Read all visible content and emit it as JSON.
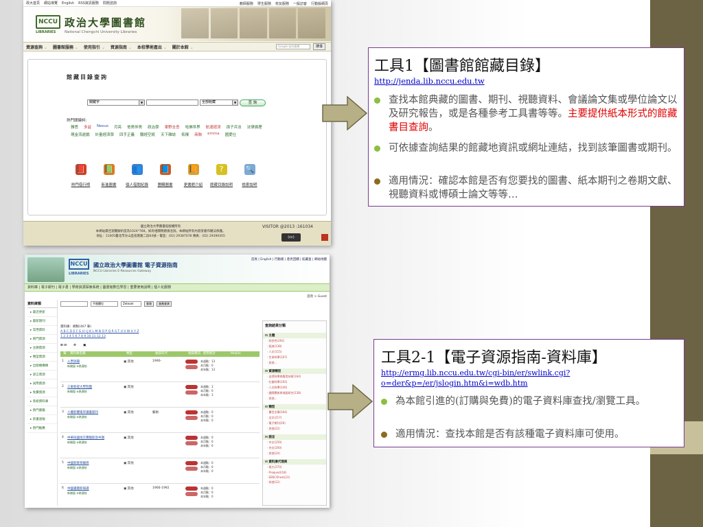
{
  "colors": {
    "side_band": "#6b6343",
    "side_band_accent": "#c8c09a",
    "box_border": "#7a3a8e",
    "arrow_fill": "#b7b087",
    "bullet_green": "#8bbf3f",
    "bullet_brown": "#8b6b1f",
    "highlight_red": "#e00000",
    "link_blue": "#0000cc"
  },
  "screenshot1": {
    "top_links": [
      "政大首頁",
      "網站導覽",
      "English",
      "RSS資訊服務",
      "問題諮詢"
    ],
    "top_right_links": [
      "教師服務",
      "學生服務",
      "校友服務",
      "一般訪客",
      "行動版網頁"
    ],
    "logo_text": "NCCU",
    "logo_sub": "LIBRARIES",
    "site_title": "政治大學圖書館",
    "site_subtitle": "National Chengchi University Libraries",
    "nav": [
      "資源查詢",
      "圖書館服務",
      "使用指引",
      "資源指南",
      "本校學術產出",
      "關於本館"
    ],
    "google_placeholder": "Google 站內搜尋",
    "google_button": "搜尋",
    "panel_title": "館藏目錄查詢",
    "field_select": "關鍵字",
    "scope_select": "全部館藏",
    "query_button": "查 詢",
    "hot_label": "熱門關鍵詞:",
    "hot_keywords": [
      {
        "t": "雅思",
        "c": ""
      },
      {
        "t": "多益",
        "c": "r"
      },
      {
        "t": "Nexus",
        "c": "b"
      },
      {
        "t": "月亮",
        "c": ""
      },
      {
        "t": "他男伴男",
        "c": ""
      },
      {
        "t": "政治學",
        "c": ""
      },
      {
        "t": "東野圭吾",
        "c": "r"
      },
      {
        "t": "哈佛世界",
        "c": ""
      },
      {
        "t": "航運經濟",
        "c": "r"
      },
      {
        "t": "孫子兵法",
        "c": ""
      },
      {
        "t": "法律倫理",
        "c": ""
      },
      {
        "t": "現金流遊戲",
        "c": ""
      },
      {
        "t": "計量經濟學",
        "c": ""
      },
      {
        "t": "四手正義",
        "c": ""
      },
      {
        "t": "聽經空統",
        "c": ""
      },
      {
        "t": "天下雜誌",
        "c": ""
      },
      {
        "t": "拓撲",
        "c": ""
      },
      {
        "t": "商鞅",
        "c": "r"
      },
      {
        "t": "emma",
        "c": "r"
      },
      {
        "t": "國愛仕",
        "c": ""
      }
    ],
    "icons": [
      {
        "glyph": "📕",
        "label": "熱門借行榜",
        "bg": "#d2401f"
      },
      {
        "glyph": "📗",
        "label": "新進圖書",
        "bg": "#e07a1f"
      },
      {
        "glyph": "👥",
        "label": "個人借閱紀錄",
        "bg": "#3a7fd0"
      },
      {
        "glyph": "📘",
        "label": "團購圖書",
        "bg": "#d05a20"
      },
      {
        "glyph": "📙",
        "label": "更書館介紹",
        "bg": "#e0a01f"
      },
      {
        "glyph": "?",
        "label": "館藏目錄說明",
        "bg": "#d8c020"
      },
      {
        "glyph": "🔍",
        "label": "檢索說明",
        "bg": "#7aaad8"
      }
    ],
    "footer_lines": [
      "國立政治大學圖書館版權所有",
      "本網站最佳瀏覽解析度為1024*768，如有相關問題請洽詢，本網站所有內容受著作權法保護。",
      "地址：11605臺北市文山區指南路二段64號・電話：(02) 29387078 傳真：(02) 29390455"
    ],
    "visitor": "VISITOR @2013 :161034"
  },
  "screenshot2": {
    "logo_text": "NCCU",
    "logo_sub": "LIBRARIES",
    "title": "國立政治大學圖書館 電子資源指南",
    "subtitle": "NCCU Libraries E-Resources Gateway",
    "top_links": "首頁 | English | 行動版 | 意見回饋 | 館藏查 | 網站地圖",
    "nav": "資料庫 | 電子期刊 | 電子書 | 學術資源探索系統 | 圖書館數位學習 | 重要使用說明 | 個人化服務",
    "crumb": "首頁 > Guest",
    "side_head": "資料庫類",
    "side_items": [
      "最近更新",
      "最新期刊",
      "常用資料",
      "熱門資源",
      "主題資源",
      "類型資源",
      "出版機構類",
      "語言資源",
      "試用資源",
      "免費資源",
      "系統資料庫",
      "熱門書籍",
      "新書速報",
      "熱門推薦"
    ],
    "search": {
      "field": "不限欄位",
      "mode": "Zeteam",
      "btn1": "查詢",
      "btn2": "進階查詢"
    },
    "alpha": "資料庫：網製(467 筆)",
    "table_head": [
      "筆數",
      "資料庫名稱",
      "類型",
      "收錄年代",
      "收錄資訊",
      "使用統計",
      "Mobile"
    ],
    "rows": [
      {
        "num": "1",
        "title": "入學詞冊",
        "type": "其他",
        "year": "1990-",
        "stats": "本週點：13 / 本月點：0 / 本年點：13"
      },
      {
        "num": "2",
        "title": "三軍新提大學院團",
        "type": "其他",
        "year": "",
        "stats": "本週點：3 / 本月點：0 / 本年點：3"
      },
      {
        "num": "3",
        "title": "人權影響兩岸讀書部刊",
        "type": "其他",
        "year": "藝術",
        "stats": "本週點：0 / 本月點：0 / 本年點：0"
      },
      {
        "num": "4",
        "title": "中華民國地方實驗影及中期",
        "type": "其他",
        "year": "",
        "stats": "本週點：0 / 本月點：0 / 本年點：0"
      },
      {
        "num": "5",
        "title": "中國新教育輔導",
        "type": "其他",
        "year": "",
        "stats": "本週點：0 / 本月點：0 / 本年點：0"
      },
      {
        "num": "6",
        "title": "中國書圖新報選",
        "type": "其他",
        "year": "1966-1992",
        "stats": "本週點：0 / 本月點：0 / 本年點：0"
      }
    ],
    "right_head": "查詢結果分類",
    "right_sections": [
      {
        "head": "主題",
        "items": [
          "綜合性(292)",
          "經濟(138)",
          "人文(115)",
          "生命科學(107)",
          "其他..."
        ]
      },
      {
        "head": "資源類型",
        "items": [
          "自然科學與應用技術(164)",
          "社會科學(165)",
          "人文科學(140)",
          "國際關係與地區研究(138)",
          "其他..."
        ]
      },
      {
        "head": "類型",
        "items": [
          "書目文摘(164)",
          "全文(217)",
          "電子期刊(26)",
          "其他(22)"
        ]
      },
      {
        "head": "語言",
        "items": [
          "中文(259)",
          "外文(200)",
          "其他(24)"
        ]
      },
      {
        "head": "資料庫代理商",
        "items": [
          "政大(270)",
          "Proquest(18)",
          "EBSCOhost(23)",
          "其他(12)"
        ]
      }
    ]
  },
  "box1": {
    "title": "工具1【圖書館館藏目錄】",
    "url": "http://jenda.lib.nccu.edu.tw",
    "bullet1_a": "查找本館典藏的圖書、期刊、視聽資料、會議論文集或學位論文以及研究報告，或是各種參考工具書等等。",
    "bullet1_red": "主要提供紙本形式的館藏書目查詢",
    "bullet1_end": "。",
    "bullet2": "可依據查詢結果的館藏地資訊或網址連結，找到該筆圖書或期刊。",
    "bullet3": "適用情況：確認本館是否有您要找的圖書、紙本期刊之卷期文獻、視聽資料或博碩士論文等等…"
  },
  "box2": {
    "title": "工具2-1【電子資源指南-資料庫】",
    "url": "http://ermg.lib.nccu.edu.tw/cgi-bin/er/swlink.cgi?o=der&p=/er/jslogin.htm&i=wdb.htm",
    "bullet1": "為本館引進的(訂購與免費)的電子資料庫查找/瀏覽工具。",
    "bullet2": "適用情況：查找本館是否有該種電子資料庫可使用。"
  }
}
